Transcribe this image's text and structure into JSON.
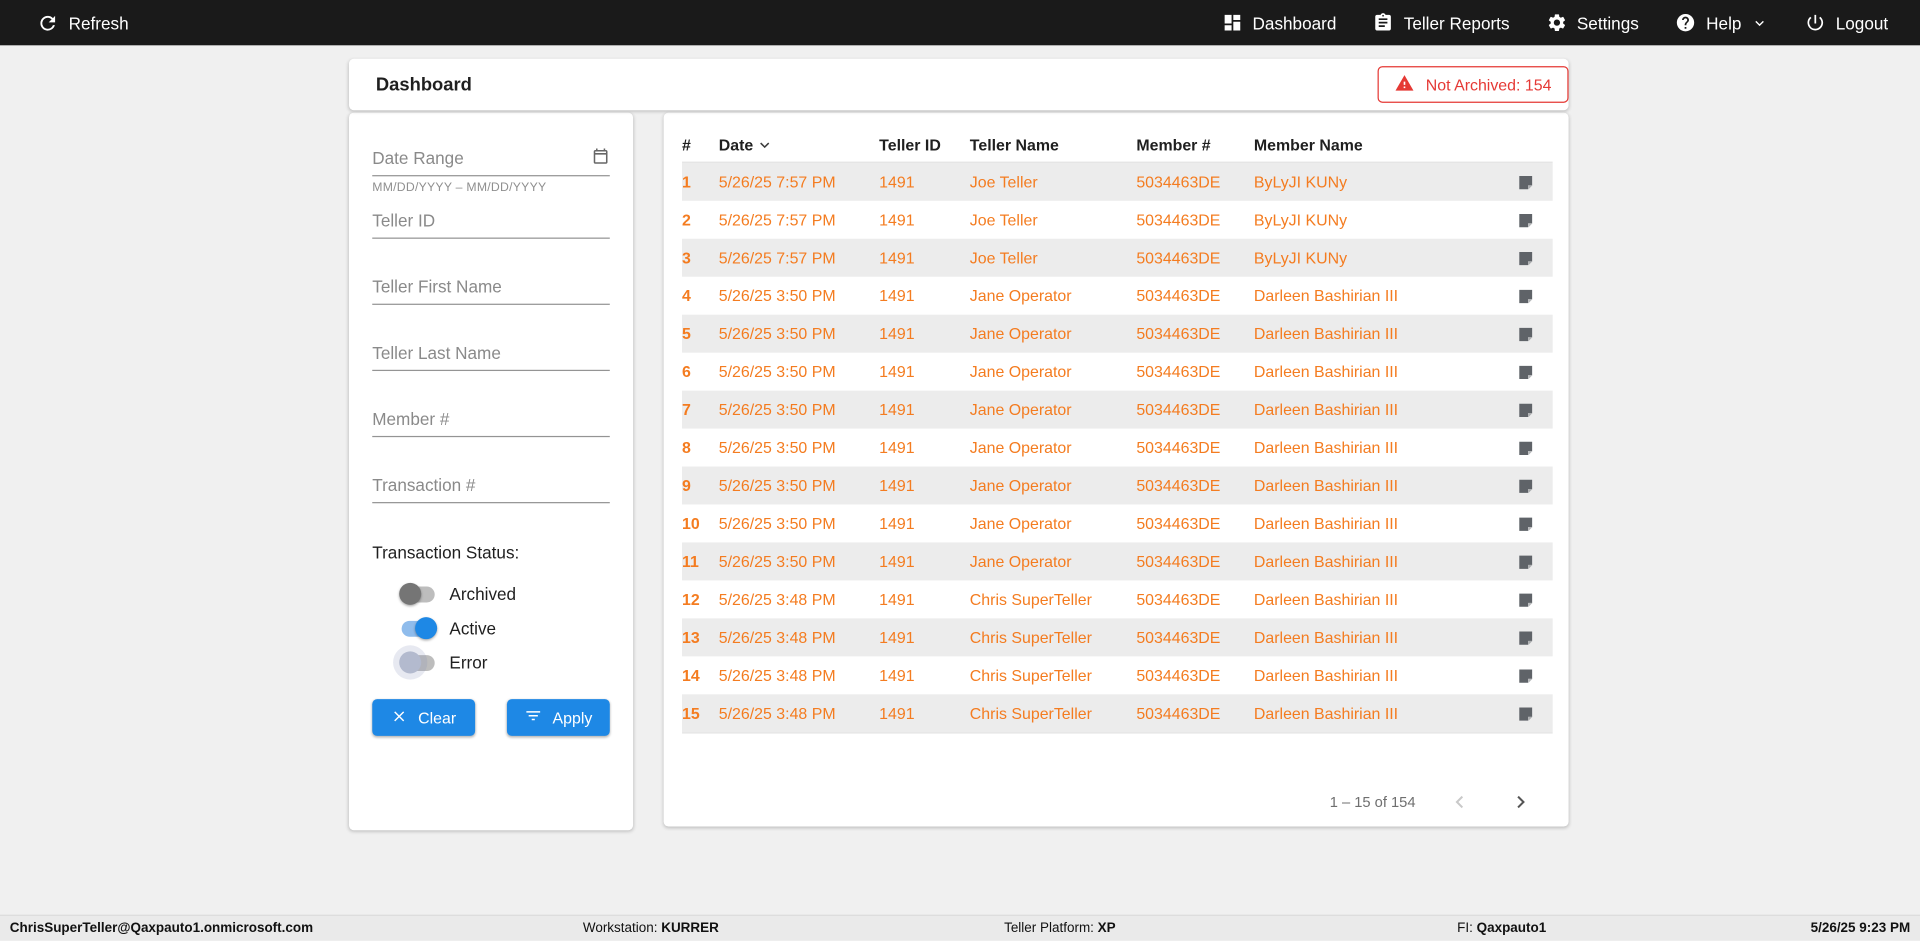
{
  "colors": {
    "topbar": "#1a1a1a",
    "orange": "#f47c20",
    "blue": "#1e88e5",
    "red": "#e53935"
  },
  "topbar": {
    "refresh_label": "Refresh",
    "nav": [
      {
        "icon": "dashboard-icon",
        "label": "Dashboard"
      },
      {
        "icon": "teller-reports-icon",
        "label": "Teller Reports"
      },
      {
        "icon": "gear-icon",
        "label": "Settings"
      },
      {
        "icon": "help-icon",
        "label": "Help",
        "chevron": true
      },
      {
        "icon": "power-icon",
        "label": "Logout"
      }
    ]
  },
  "header": {
    "title": "Dashboard",
    "not_archived_badge": "Not Archived: 154"
  },
  "filters": {
    "date_range": {
      "placeholder": "Date Range",
      "value": "",
      "hint": "MM/DD/YYYY – MM/DD/YYYY"
    },
    "teller_id": {
      "placeholder": "Teller ID",
      "value": ""
    },
    "teller_first_name": {
      "placeholder": "Teller First Name",
      "value": ""
    },
    "teller_last_name": {
      "placeholder": "Teller Last Name",
      "value": ""
    },
    "member_number": {
      "placeholder": "Member #",
      "value": ""
    },
    "transaction_number": {
      "placeholder": "Transaction #",
      "value": ""
    },
    "status_label": "Transaction Status:",
    "toggles": [
      {
        "label": "Archived",
        "on": false
      },
      {
        "label": "Active",
        "on": true
      },
      {
        "label": "Error",
        "on": false
      }
    ],
    "clear_label": "Clear",
    "apply_label": "Apply"
  },
  "table": {
    "columns": [
      "#",
      "Date",
      "Teller ID",
      "Teller Name",
      "Member #",
      "Member Name"
    ],
    "sort_column": "Date",
    "rows": [
      {
        "num": "1",
        "date": "5/26/25 7:57 PM",
        "teller_id": "1491",
        "teller_name": "Joe Teller",
        "member": "5034463DE",
        "member_name": "ByLyJI KUNy"
      },
      {
        "num": "2",
        "date": "5/26/25 7:57 PM",
        "teller_id": "1491",
        "teller_name": "Joe Teller",
        "member": "5034463DE",
        "member_name": "ByLyJI KUNy"
      },
      {
        "num": "3",
        "date": "5/26/25 7:57 PM",
        "teller_id": "1491",
        "teller_name": "Joe Teller",
        "member": "5034463DE",
        "member_name": "ByLyJI KUNy"
      },
      {
        "num": "4",
        "date": "5/26/25 3:50 PM",
        "teller_id": "1491",
        "teller_name": "Jane Operator",
        "member": "5034463DE",
        "member_name": "Darleen Bashirian III"
      },
      {
        "num": "5",
        "date": "5/26/25 3:50 PM",
        "teller_id": "1491",
        "teller_name": "Jane Operator",
        "member": "5034463DE",
        "member_name": "Darleen Bashirian III"
      },
      {
        "num": "6",
        "date": "5/26/25 3:50 PM",
        "teller_id": "1491",
        "teller_name": "Jane Operator",
        "member": "5034463DE",
        "member_name": "Darleen Bashirian III"
      },
      {
        "num": "7",
        "date": "5/26/25 3:50 PM",
        "teller_id": "1491",
        "teller_name": "Jane Operator",
        "member": "5034463DE",
        "member_name": "Darleen Bashirian III"
      },
      {
        "num": "8",
        "date": "5/26/25 3:50 PM",
        "teller_id": "1491",
        "teller_name": "Jane Operator",
        "member": "5034463DE",
        "member_name": "Darleen Bashirian III"
      },
      {
        "num": "9",
        "date": "5/26/25 3:50 PM",
        "teller_id": "1491",
        "teller_name": "Jane Operator",
        "member": "5034463DE",
        "member_name": "Darleen Bashirian III"
      },
      {
        "num": "10",
        "date": "5/26/25 3:50 PM",
        "teller_id": "1491",
        "teller_name": "Jane Operator",
        "member": "5034463DE",
        "member_name": "Darleen Bashirian III"
      },
      {
        "num": "11",
        "date": "5/26/25 3:50 PM",
        "teller_id": "1491",
        "teller_name": "Jane Operator",
        "member": "5034463DE",
        "member_name": "Darleen Bashirian III"
      },
      {
        "num": "12",
        "date": "5/26/25 3:48 PM",
        "teller_id": "1491",
        "teller_name": "Chris SuperTeller",
        "member": "5034463DE",
        "member_name": "Darleen Bashirian III"
      },
      {
        "num": "13",
        "date": "5/26/25 3:48 PM",
        "teller_id": "1491",
        "teller_name": "Chris SuperTeller",
        "member": "5034463DE",
        "member_name": "Darleen Bashirian III"
      },
      {
        "num": "14",
        "date": "5/26/25 3:48 PM",
        "teller_id": "1491",
        "teller_name": "Chris SuperTeller",
        "member": "5034463DE",
        "member_name": "Darleen Bashirian III"
      },
      {
        "num": "15",
        "date": "5/26/25 3:48 PM",
        "teller_id": "1491",
        "teller_name": "Chris SuperTeller",
        "member": "5034463DE",
        "member_name": "Darleen Bashirian III"
      }
    ],
    "pagination": {
      "range_label": "1 – 15 of 154"
    }
  },
  "statusbar": {
    "user": "ChrisSuperTeller@Qaxpauto1.onmicrosoft.com",
    "workstation_label": "Workstation:",
    "workstation_value": "KURRER",
    "platform_label": "Teller Platform:",
    "platform_value": "XP",
    "fi_label": "FI:",
    "fi_value": "Qaxpauto1",
    "datetime": "5/26/25 9:23 PM"
  }
}
